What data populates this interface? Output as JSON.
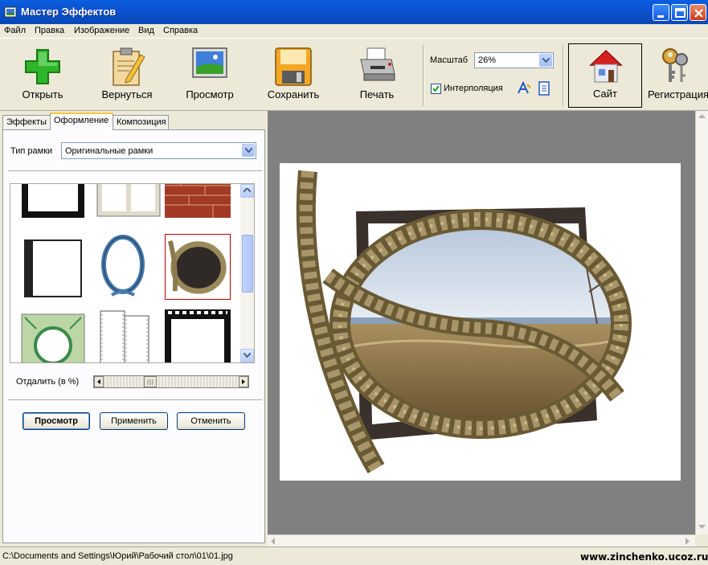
{
  "window": {
    "title": "Мастер Эффектов"
  },
  "menu": [
    "Файл",
    "Правка",
    "Изображение",
    "Вид",
    "Справка"
  ],
  "toolbar": {
    "open_label": "Открыть",
    "back_label": "Вернуться",
    "preview_label": "Просмотр",
    "save_label": "Сохранить",
    "print_label": "Печать",
    "site_label": "Сайт",
    "register_label": "Регистрация",
    "zoom_label": "Масштаб",
    "zoom_value": "26%",
    "interp_label": "Интерполяция",
    "interp_checked": true
  },
  "tabs": [
    "Эффекты",
    "Оформление",
    "Композиция"
  ],
  "active_tab": "Оформление",
  "frame": {
    "type_label": "Тип рамки",
    "type_value": "Оригинальные рамки",
    "distance_label": "Отдалить (в %)"
  },
  "buttons": {
    "preview": "Просмотр",
    "apply": "Применить",
    "cancel": "Отменить"
  },
  "status": {
    "path": "C:\\Documents and Settings\\Юрий\\Рабочий стол\\01\\01.jpg",
    "watermark": "www.zinchenko.ucoz.ru"
  },
  "colors": {
    "titlebar": "#0b53d0",
    "window_bg": "#ece9d8",
    "preview_bg": "#808080",
    "selection": "#c00000"
  }
}
